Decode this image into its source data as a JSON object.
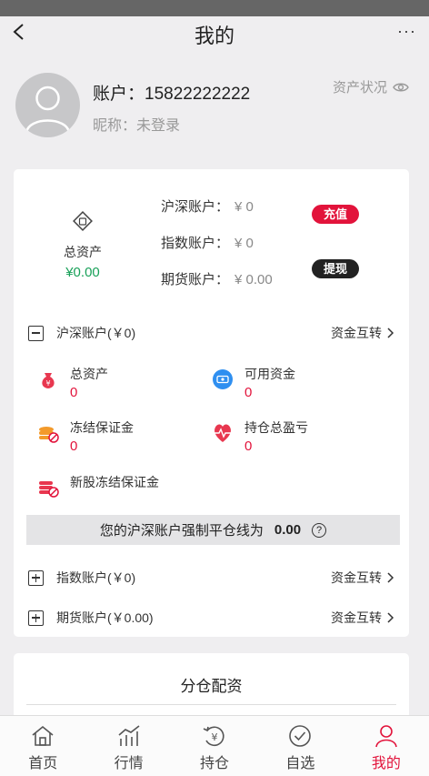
{
  "header": {
    "title": "我的",
    "more_label": "···"
  },
  "profile": {
    "account_label": "账户：",
    "account_value": "15822222222",
    "nickname_label": "昵称：",
    "nickname_value": "未登录",
    "asset_status_label": "资产状况"
  },
  "summary": {
    "total_label": "总资产",
    "total_value": "¥0.00",
    "accounts": [
      {
        "label": "沪深账户：",
        "value": "¥ 0"
      },
      {
        "label": "指数账户：",
        "value": "¥ 0"
      },
      {
        "label": "期货账户：",
        "value": "¥ 0.00"
      }
    ],
    "recharge_label": "充值",
    "withdraw_label": "提现"
  },
  "sections": {
    "hushen": {
      "label": "沪深账户(￥0)",
      "transfer_label": "资金互转",
      "expanded": true
    },
    "index": {
      "label": "指数账户(￥0)",
      "transfer_label": "资金互转",
      "expanded": false
    },
    "futures": {
      "label": "期货账户(￥0.00)",
      "transfer_label": "资金互转",
      "expanded": false
    }
  },
  "metrics": [
    {
      "label": "总资产",
      "value": "0",
      "icon": "money-bag-icon"
    },
    {
      "label": "可用资金",
      "value": "0",
      "icon": "cash-icon"
    },
    {
      "label": "冻结保证金",
      "value": "0",
      "icon": "frozen-coins-icon"
    },
    {
      "label": "持仓总盈亏",
      "value": "0",
      "icon": "pulse-icon"
    },
    {
      "label": "新股冻结保证金",
      "value": "",
      "icon": "ipo-frozen-icon"
    }
  ],
  "liquidation": {
    "text": "您的沪深账户强制平仓线为",
    "value": "0.00",
    "help": "?"
  },
  "allocation": {
    "title": "分仓配资"
  },
  "tabs": [
    {
      "label": "首页",
      "icon": "home-icon",
      "active": false
    },
    {
      "label": "行情",
      "icon": "chart-icon",
      "active": false
    },
    {
      "label": "持仓",
      "icon": "position-icon",
      "active": false
    },
    {
      "label": "自选",
      "icon": "check-circle-icon",
      "active": false
    },
    {
      "label": "我的",
      "icon": "user-icon",
      "active": true
    }
  ],
  "colors": {
    "accent_red": "#e2133b",
    "green": "#18a058",
    "background": "#efeef0"
  }
}
